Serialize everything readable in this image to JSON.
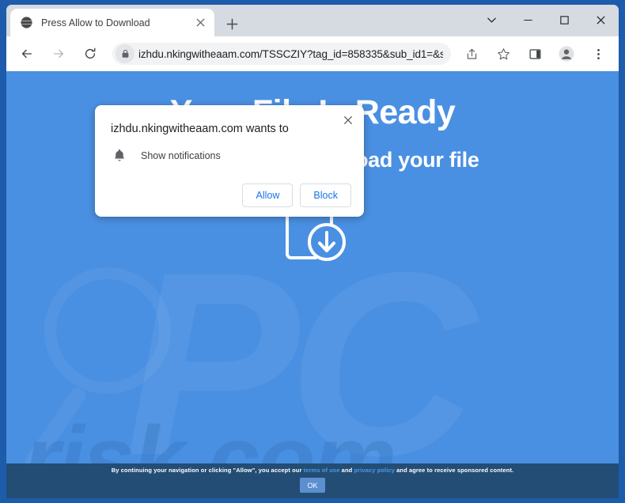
{
  "browser": {
    "tab": {
      "title": "Press Allow to Download",
      "favicon_icon": "globe-icon",
      "close_icon": "close-icon"
    },
    "new_tab_icon": "plus-icon",
    "window_controls": {
      "tab_search_icon": "chevron-down-icon",
      "minimize_icon": "minimize-icon",
      "maximize_icon": "maximize-icon",
      "close_icon": "close-icon"
    },
    "toolbar": {
      "back_icon": "arrow-left-icon",
      "forward_icon": "arrow-right-icon",
      "reload_icon": "reload-icon",
      "lock_icon": "lock-icon",
      "url": "izhdu.nkingwitheaam.com/TSSCZIY?tag_id=858335&sub_id1=&su…",
      "share_icon": "share-icon",
      "bookmark_icon": "star-icon",
      "side_panel_icon": "side-panel-icon",
      "profile_icon": "profile-avatar-icon",
      "menu_icon": "three-dot-menu-icon"
    }
  },
  "dialog": {
    "title": "izhdu.nkingwitheaam.com wants to",
    "permission_icon": "bell-icon",
    "permission_label": "Show notifications",
    "allow_label": "Allow",
    "block_label": "Block",
    "close_icon": "close-icon"
  },
  "page": {
    "heading": "Your File Is Ready",
    "subheading": "Press Allow to download your file",
    "illustration_icon": "book-download-icon",
    "watermark_logo": "PC",
    "watermark_text": "risk.com",
    "background_color": "#4a90e2"
  },
  "consent_bar": {
    "text_before": "By continuing your navigation or clicking \"Allow\", you accept our ",
    "terms_link": "terms of use",
    "text_between": " and ",
    "privacy_link": "privacy policy",
    "text_after": " and agree to receive sponsored content.",
    "ok_label": "OK",
    "background_color": "#234d74",
    "link_color": "#4c9ae8"
  }
}
